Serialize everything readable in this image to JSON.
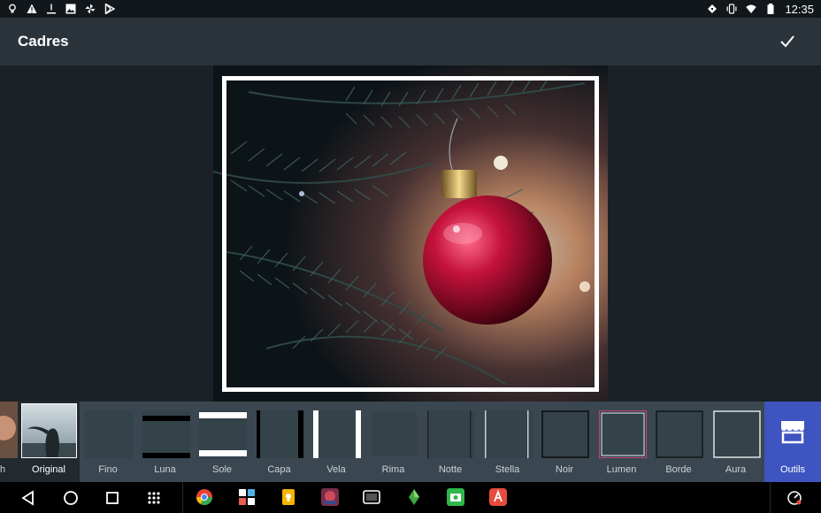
{
  "status_bar": {
    "time": "12:35",
    "left_icons": [
      "lightbulb-icon",
      "warning-icon",
      "download-icon",
      "image-icon",
      "pinwheel-icon",
      "play-store-icon"
    ],
    "right_icons": [
      "notification-icon",
      "vibrate-icon",
      "wifi-icon",
      "battery-icon"
    ]
  },
  "app_bar": {
    "title": "Cadres",
    "confirm_icon": "check-icon"
  },
  "frame_strip": {
    "partial_label": "h",
    "original_label": "Original",
    "frames": [
      {
        "label": "Fino",
        "style": "none"
      },
      {
        "label": "Luna",
        "style": "h-thick"
      },
      {
        "label": "Sole",
        "style": "h-white"
      },
      {
        "label": "Capa",
        "style": "v-black"
      },
      {
        "label": "Vela",
        "style": "v-white"
      },
      {
        "label": "Rima",
        "style": "rima"
      },
      {
        "label": "Notte",
        "style": "v-thin-dark"
      },
      {
        "label": "Stella",
        "style": "v-thin-light"
      },
      {
        "label": "Noir",
        "style": "box-black"
      },
      {
        "label": "Lumen",
        "style": "box-pink"
      },
      {
        "label": "Borde",
        "style": "box-dark"
      },
      {
        "label": "Aura",
        "style": "box-light"
      }
    ],
    "tools_label": "Outils",
    "tools_icon": "store-icon"
  },
  "nav_bar": {
    "buttons": [
      "back-icon",
      "home-icon",
      "recents-icon",
      "app-drawer-icon"
    ],
    "dock_apps": [
      "chrome-icon",
      "photo-collage-icon",
      "keep-icon",
      "game-icon",
      "media-icon",
      "snapseed-icon",
      "camera-app-icon",
      "adobe-app-icon"
    ],
    "accent_colors": {
      "chrome": "#e94235",
      "keep": "#f5b400",
      "snapseed": "#3ea843",
      "camera": "#2fb84a",
      "adobe": "#e84c3d"
    }
  },
  "colors": {
    "app_bar": "#2b343b",
    "canvas": "#1a2127",
    "strip": "#3b4750",
    "tools_accent": "#3e54c0",
    "selected_frame": "#c2477a"
  }
}
